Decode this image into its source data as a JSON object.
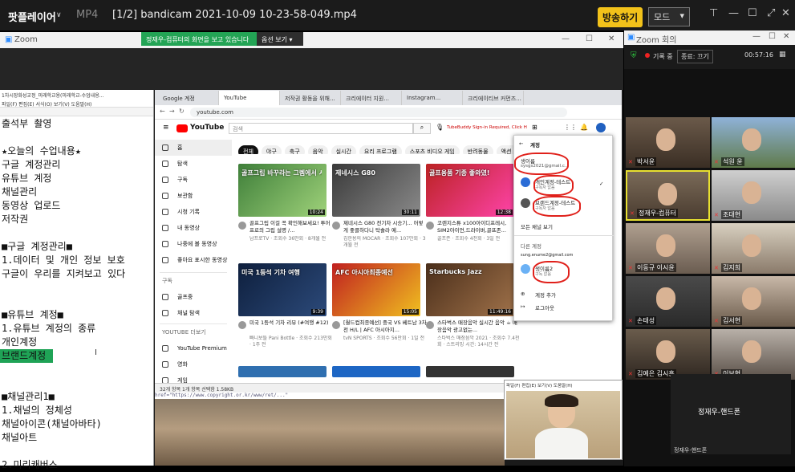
{
  "player": {
    "app_name": "팟플레이어",
    "format": "MP4",
    "title": "[1/2] bandicam 2021-10-09 10-23-58-049.mp4",
    "broadcast_btn": "방송하기",
    "mode_btn": "모드"
  },
  "zoom_main": {
    "window_title": "Zoom",
    "share_banner": "정재우-컴퓨터의 화면을 보고 있습니다",
    "view_options": "옵션 보기"
  },
  "notepad": {
    "title": "1차시장화성교정_미래학교용(미래학교-수업내용...",
    "menu": "파일(F)  편집(E)  서식(O)  보기(V)  도움말(H)",
    "lines": [
      "출석부 촬영",
      "",
      "★오늘의 수업내용★",
      "구글 계정관리",
      "유튜브 계정",
      "채널관리",
      "동영상 업로드",
      "저작권",
      "",
      "■구글 계정관리■",
      "1.데이터 및 개인 정보 보호",
      "구글이 우리를 지켜보고 있다",
      "",
      "",
      "■유튜브 계정■",
      "1.유튜브 계정의 종류",
      "개인계정",
      "브랜드계정",
      "",
      "",
      "■채널관리1■",
      "1.채널의 정체성",
      "채널아이콘(채널아바타)",
      "채널아트",
      "",
      "2.미리캐버스"
    ],
    "highlight_line": 17
  },
  "browser": {
    "tabs": [
      "Google 계정",
      "YouTube",
      "저작권 활동을 위해...",
      "크리에이터 지원...",
      "Instagram...",
      "크리에이티브 커먼즈..."
    ],
    "url": "youtube.com",
    "search_placeholder": "검색",
    "translate_notice": "TubeBuddy Sign-in Required, Click Here",
    "chips": [
      "전체",
      "야구",
      "축구",
      "음악",
      "실시간",
      "요리 프로그램",
      "스포츠 비디오 게임",
      "반려동물",
      "액션 어드벤처 게임"
    ],
    "sidebar": [
      "홈",
      "탐색",
      "구독",
      "보관함",
      "시청 기록",
      "내 동영상",
      "나중에 볼 동영상",
      "좋아요 표시한 동영상"
    ],
    "sidebar2_header": "구독",
    "sidebar2": [
      "골프중",
      "채널 탐색"
    ],
    "more_header": "YOUTUBE 더보기",
    "more": [
      "YouTube Premium",
      "영화",
      "게임"
    ],
    "videos": [
      {
        "title": "골프그립 이걸 꼭 확인해보세요! 투어프로의 그립 설명 /...",
        "meta": "남프로TV · 조회수 36만회 · 8개월 전",
        "dur": "10:24",
        "thumb_text": "골프그립 바꾸라는 그렘에서 시작합니다"
      },
      {
        "title": "제네시스 G80 전기차 시승기... 어렇게 좋클하다니 탁솔라 예...",
        "meta": "김한용의 MOCAR · 조회수 107만회 · 3개월 전",
        "dur": "30:11",
        "thumb_text": "제네시스 G80"
      },
      {
        "title": "코렌지스튜 x100아이디프레시, SIM2아이언,드라이버,골프존...",
        "meta": "골프존 · 조회수 4천회 · 3일 전",
        "dur": "12:38",
        "thumb_text": "골프용품 기종 좋와였!"
      },
      {
        "title": "미국 1등석 기차 리뷰 (#여행 #12)",
        "meta": "빠니보틀 Pani Bottle · 조회수 213만회 · 1주 전",
        "dur": "9:39",
        "thumb_text": "미국 1등석 기차 여행"
      },
      {
        "title": "[월드컵최종예선] 중국 VS 베트남 3차전 H/L | AFC 아시아지...",
        "meta": "tvN SPORTS · 조회수 56만회 · 1일 전",
        "dur": "15:05",
        "thumb_text": "AFC 아시아최종예선"
      },
      {
        "title": "스타벅스 매장음악 실시간 음악 ☕ 매장음악 광고없는...",
        "meta": "스타벅스 매장음악 2021 · 조회수 7.4천회 · 스트리밍 시간: 14시간 전",
        "dur": "11:49:16",
        "thumb_text": "Starbucks Jazz"
      }
    ],
    "status_text": "32개 항목     1개 항목 선택함 1.58KB"
  },
  "account_popup": {
    "header": "계정",
    "switch_label": "생이름",
    "current_email": "sysgs2021@gmail.c...",
    "acct1": "개인계정-테스트",
    "acct1_sub": "구독자 없음",
    "acct2": "브랜드계정-테스트",
    "acct2_sub": "구독자 없음",
    "all_channels": "모든 채널 보기",
    "other_header": "다른 계정",
    "other_email": "sung.enume2@gmail.com",
    "other_name": "생이름2",
    "other_sub": "구독 없음",
    "add_account": "계정 추가",
    "logout": "로그아웃"
  },
  "teacher": {
    "menu": "파일(F)  편집(E)  보기(V)  도움말(H)"
  },
  "zoom_side": {
    "title": "Zoom 회의",
    "record": "기록 중",
    "gallery": "갤러리 보기",
    "end": "종료: 끄기",
    "timer": "00:57:16",
    "tiles": [
      "박서윤",
      "석원 윤",
      "정재우-컴퓨터",
      "조대현",
      "이동규 이시윤",
      "김지희",
      "손태성",
      "김서현",
      "김예은 김시훈",
      "이보현"
    ],
    "phone_tile": "정재우-핸드폰",
    "phone_tile_label": "정재우-핸드폰"
  }
}
